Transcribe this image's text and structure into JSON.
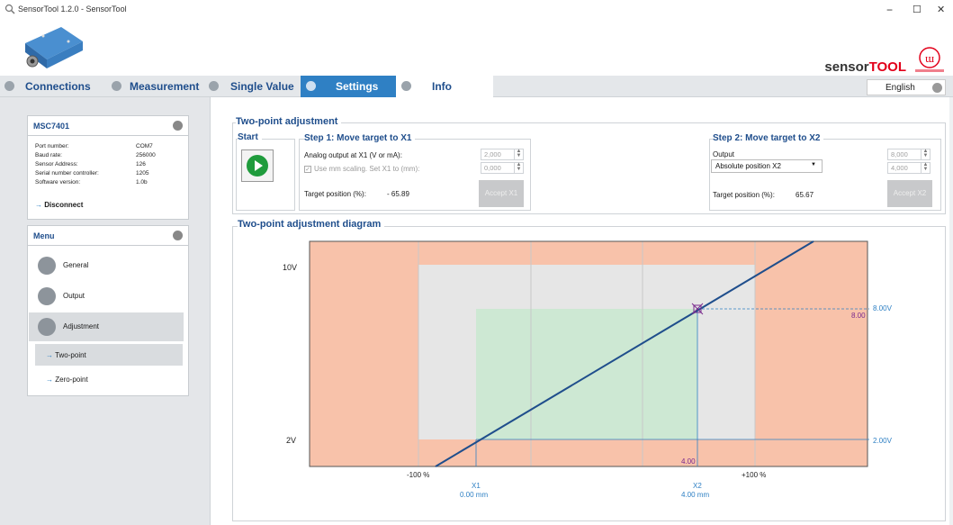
{
  "window": {
    "title": "SensorTool 1.2.0 - SensorTool",
    "minimize": "−",
    "maximize": "☐",
    "close": "✕"
  },
  "brand": {
    "sensor": "sensor",
    "tool": "TOOL"
  },
  "nav": {
    "tabs": [
      "Connections",
      "Measurement",
      "Single Value",
      "Settings",
      "Info"
    ],
    "active": "Settings",
    "language": "English"
  },
  "device": {
    "name": "MSC7401",
    "fields": [
      {
        "label": "Port number:",
        "value": "COM7"
      },
      {
        "label": "Baud rate:",
        "value": "256000"
      },
      {
        "label": "Sensor Address:",
        "value": "126"
      },
      {
        "label": "Serial number controller:",
        "value": "1205"
      },
      {
        "label": "Software version:",
        "value": "1.0b"
      }
    ],
    "disconnect": "Disconnect"
  },
  "menu": {
    "title": "Menu",
    "items": [
      "General",
      "Output",
      "Adjustment"
    ],
    "subitems": [
      "Two-point",
      "Zero-point"
    ]
  },
  "adjust": {
    "title": "Two-point adjustment",
    "start": "Start",
    "step1": {
      "title": "Step 1: Move target to X1",
      "analog_label": "Analog output at X1 (V or mA):",
      "analog_value": "2,000",
      "scaling_label": "Use mm scaling. Set X1 to (mm):",
      "scaling_value": "0,000",
      "target_label": "Target position (%):",
      "target_value": "- 65.89",
      "accept": "Accept X1"
    },
    "step2": {
      "title": "Step 2: Move target to X2",
      "output_label": "Output",
      "output_select": "Absolute position X2",
      "value1": "8,000",
      "value2": "4,000",
      "target_label": "Target position (%):",
      "target_value": "65.67",
      "accept": "Accept X2"
    }
  },
  "diagram": {
    "title": "Two-point adjustment diagram",
    "y_labels": [
      "10V",
      "2V"
    ],
    "x_labels": [
      "-100 %",
      "+100 %"
    ],
    "right_labels": [
      "8.00V",
      "2.00V"
    ],
    "x1_label": "X1",
    "x1_value": "0.00 mm",
    "x2_label": "X2",
    "x2_value": "4.00 mm",
    "mark_x": "4.00",
    "mark_y": "8.00"
  },
  "colors": {
    "accent": "#2f80c4",
    "nav_text": "#1f4e8c",
    "out_of_range": "#f8c2aa",
    "range": "#e6e6e6",
    "adjusted": "#cde8d3",
    "line": "#1f4e8c"
  }
}
